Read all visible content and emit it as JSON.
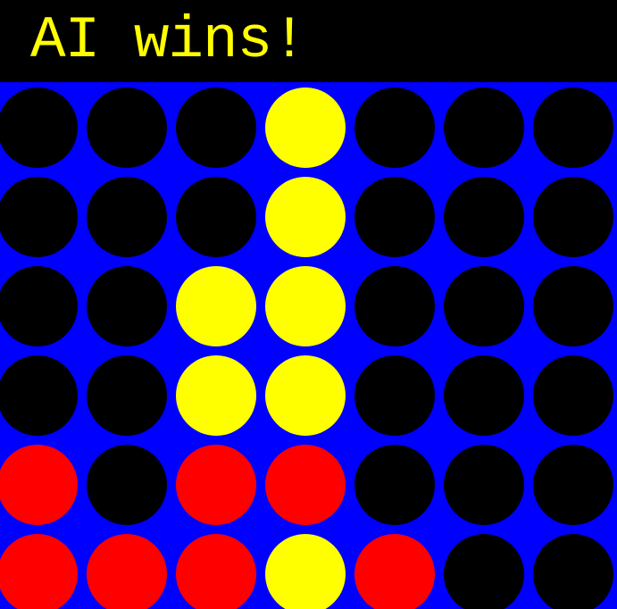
{
  "header": {
    "status_text": "AI wins!",
    "status_color": "#ffff00"
  },
  "colors": {
    "board": "#0000ff",
    "empty": "#000000",
    "player": "#ff0000",
    "ai": "#ffff00"
  },
  "board": {
    "columns": 7,
    "rows": 6,
    "cells": [
      [
        "empty",
        "empty",
        "empty",
        "ai",
        "empty",
        "empty",
        "empty"
      ],
      [
        "empty",
        "empty",
        "empty",
        "ai",
        "empty",
        "empty",
        "empty"
      ],
      [
        "empty",
        "empty",
        "ai",
        "ai",
        "empty",
        "empty",
        "empty"
      ],
      [
        "empty",
        "empty",
        "ai",
        "ai",
        "empty",
        "empty",
        "empty"
      ],
      [
        "player",
        "empty",
        "player",
        "player",
        "empty",
        "empty",
        "empty"
      ],
      [
        "player",
        "player",
        "player",
        "ai",
        "player",
        "empty",
        "empty"
      ]
    ]
  }
}
